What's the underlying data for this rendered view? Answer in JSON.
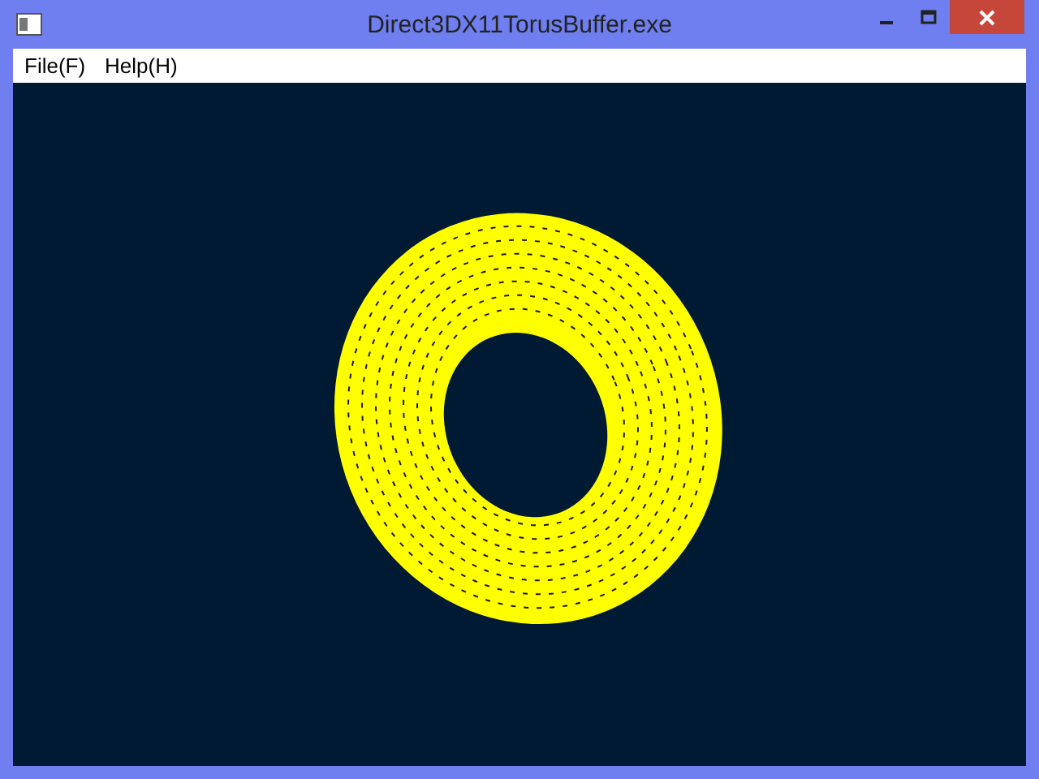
{
  "window": {
    "title": "Direct3DX11TorusBuffer.exe"
  },
  "menu": [
    {
      "label": "File(F)"
    },
    {
      "label": "Help(H)"
    }
  ],
  "viewport": {
    "kind": "torus"
  }
}
